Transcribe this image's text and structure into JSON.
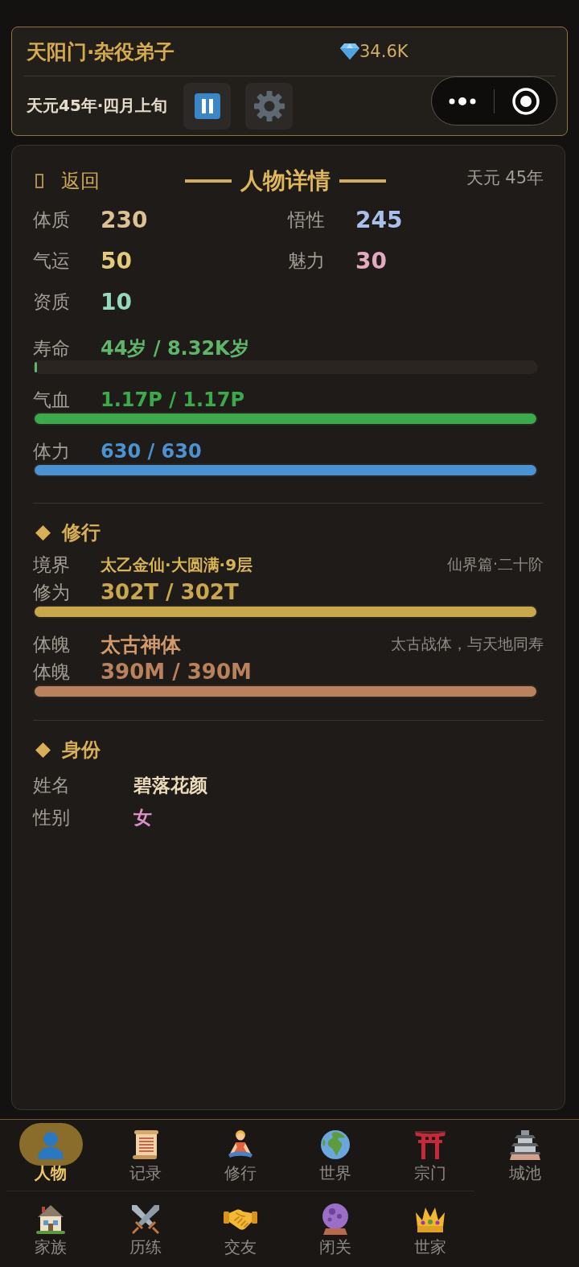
{
  "header": {
    "title": "天阳门·杂役弟子",
    "currency": "34.6K",
    "date": "天元45年·四月上旬"
  },
  "detail": {
    "back_label": "返回",
    "title": "人物详情",
    "era": "天元 45年"
  },
  "attributes": [
    {
      "label": "体质",
      "value": "230",
      "color": "#dcc293"
    },
    {
      "label": "悟性",
      "value": "245",
      "color": "#a9c1ea"
    },
    {
      "label": "气运",
      "value": "50",
      "color": "#e3c97a"
    },
    {
      "label": "魅力",
      "value": "30",
      "color": "#e2a9bf"
    },
    {
      "label": "资质",
      "value": "10",
      "color": "#93d9bd"
    }
  ],
  "vitals": [
    {
      "label": "寿命",
      "value": "44岁 / 8.32K岁",
      "level": 0.005,
      "color": "#5fb56a"
    },
    {
      "label": "气血",
      "value": "1.17P / 1.17P",
      "level": 1,
      "color": "#3aaa4a"
    },
    {
      "label": "体力",
      "value": "630 / 630",
      "level": 1,
      "color": "#4b92d2"
    }
  ],
  "cultivation": {
    "heading": "修行",
    "rows": [
      {
        "kind": "realm",
        "label": "境界",
        "value": "太乙金仙·大圆满·9层",
        "note": "仙界篇·二十阶",
        "color": "#d9b452"
      },
      {
        "kind": "bar",
        "label": "修为",
        "value": "302T / 302T",
        "level": 1,
        "color": "#c9a84c"
      },
      {
        "kind": "physique",
        "label": "体魄",
        "value": "太古神体",
        "note": "太古战体，与天地同寿",
        "color": "#d29a6a"
      },
      {
        "kind": "bar",
        "label": "体魄",
        "value": "390M / 390M",
        "level": 1,
        "color": "#b9825c"
      }
    ]
  },
  "identity": {
    "heading": "身份",
    "rows": [
      {
        "label": "姓名",
        "value": "碧落花颜",
        "color": "#ecdcbc"
      },
      {
        "label": "性别",
        "value": "女",
        "color": "#dc8fc9"
      }
    ]
  },
  "bottom_nav": [
    {
      "items": [
        {
          "label": "人物",
          "selected": true
        },
        {
          "label": "记录",
          "selected": false
        },
        {
          "label": "修行",
          "selected": false
        },
        {
          "label": "世界",
          "selected": false
        },
        {
          "label": "宗门",
          "selected": false
        },
        {
          "label": "城池",
          "selected": false
        }
      ]
    },
    {
      "items": [
        {
          "label": "家族",
          "selected": false
        },
        {
          "label": "历练",
          "selected": false
        },
        {
          "label": "交友",
          "selected": false
        },
        {
          "label": "闭关",
          "selected": false
        },
        {
          "label": "世家",
          "selected": false
        }
      ]
    }
  ]
}
